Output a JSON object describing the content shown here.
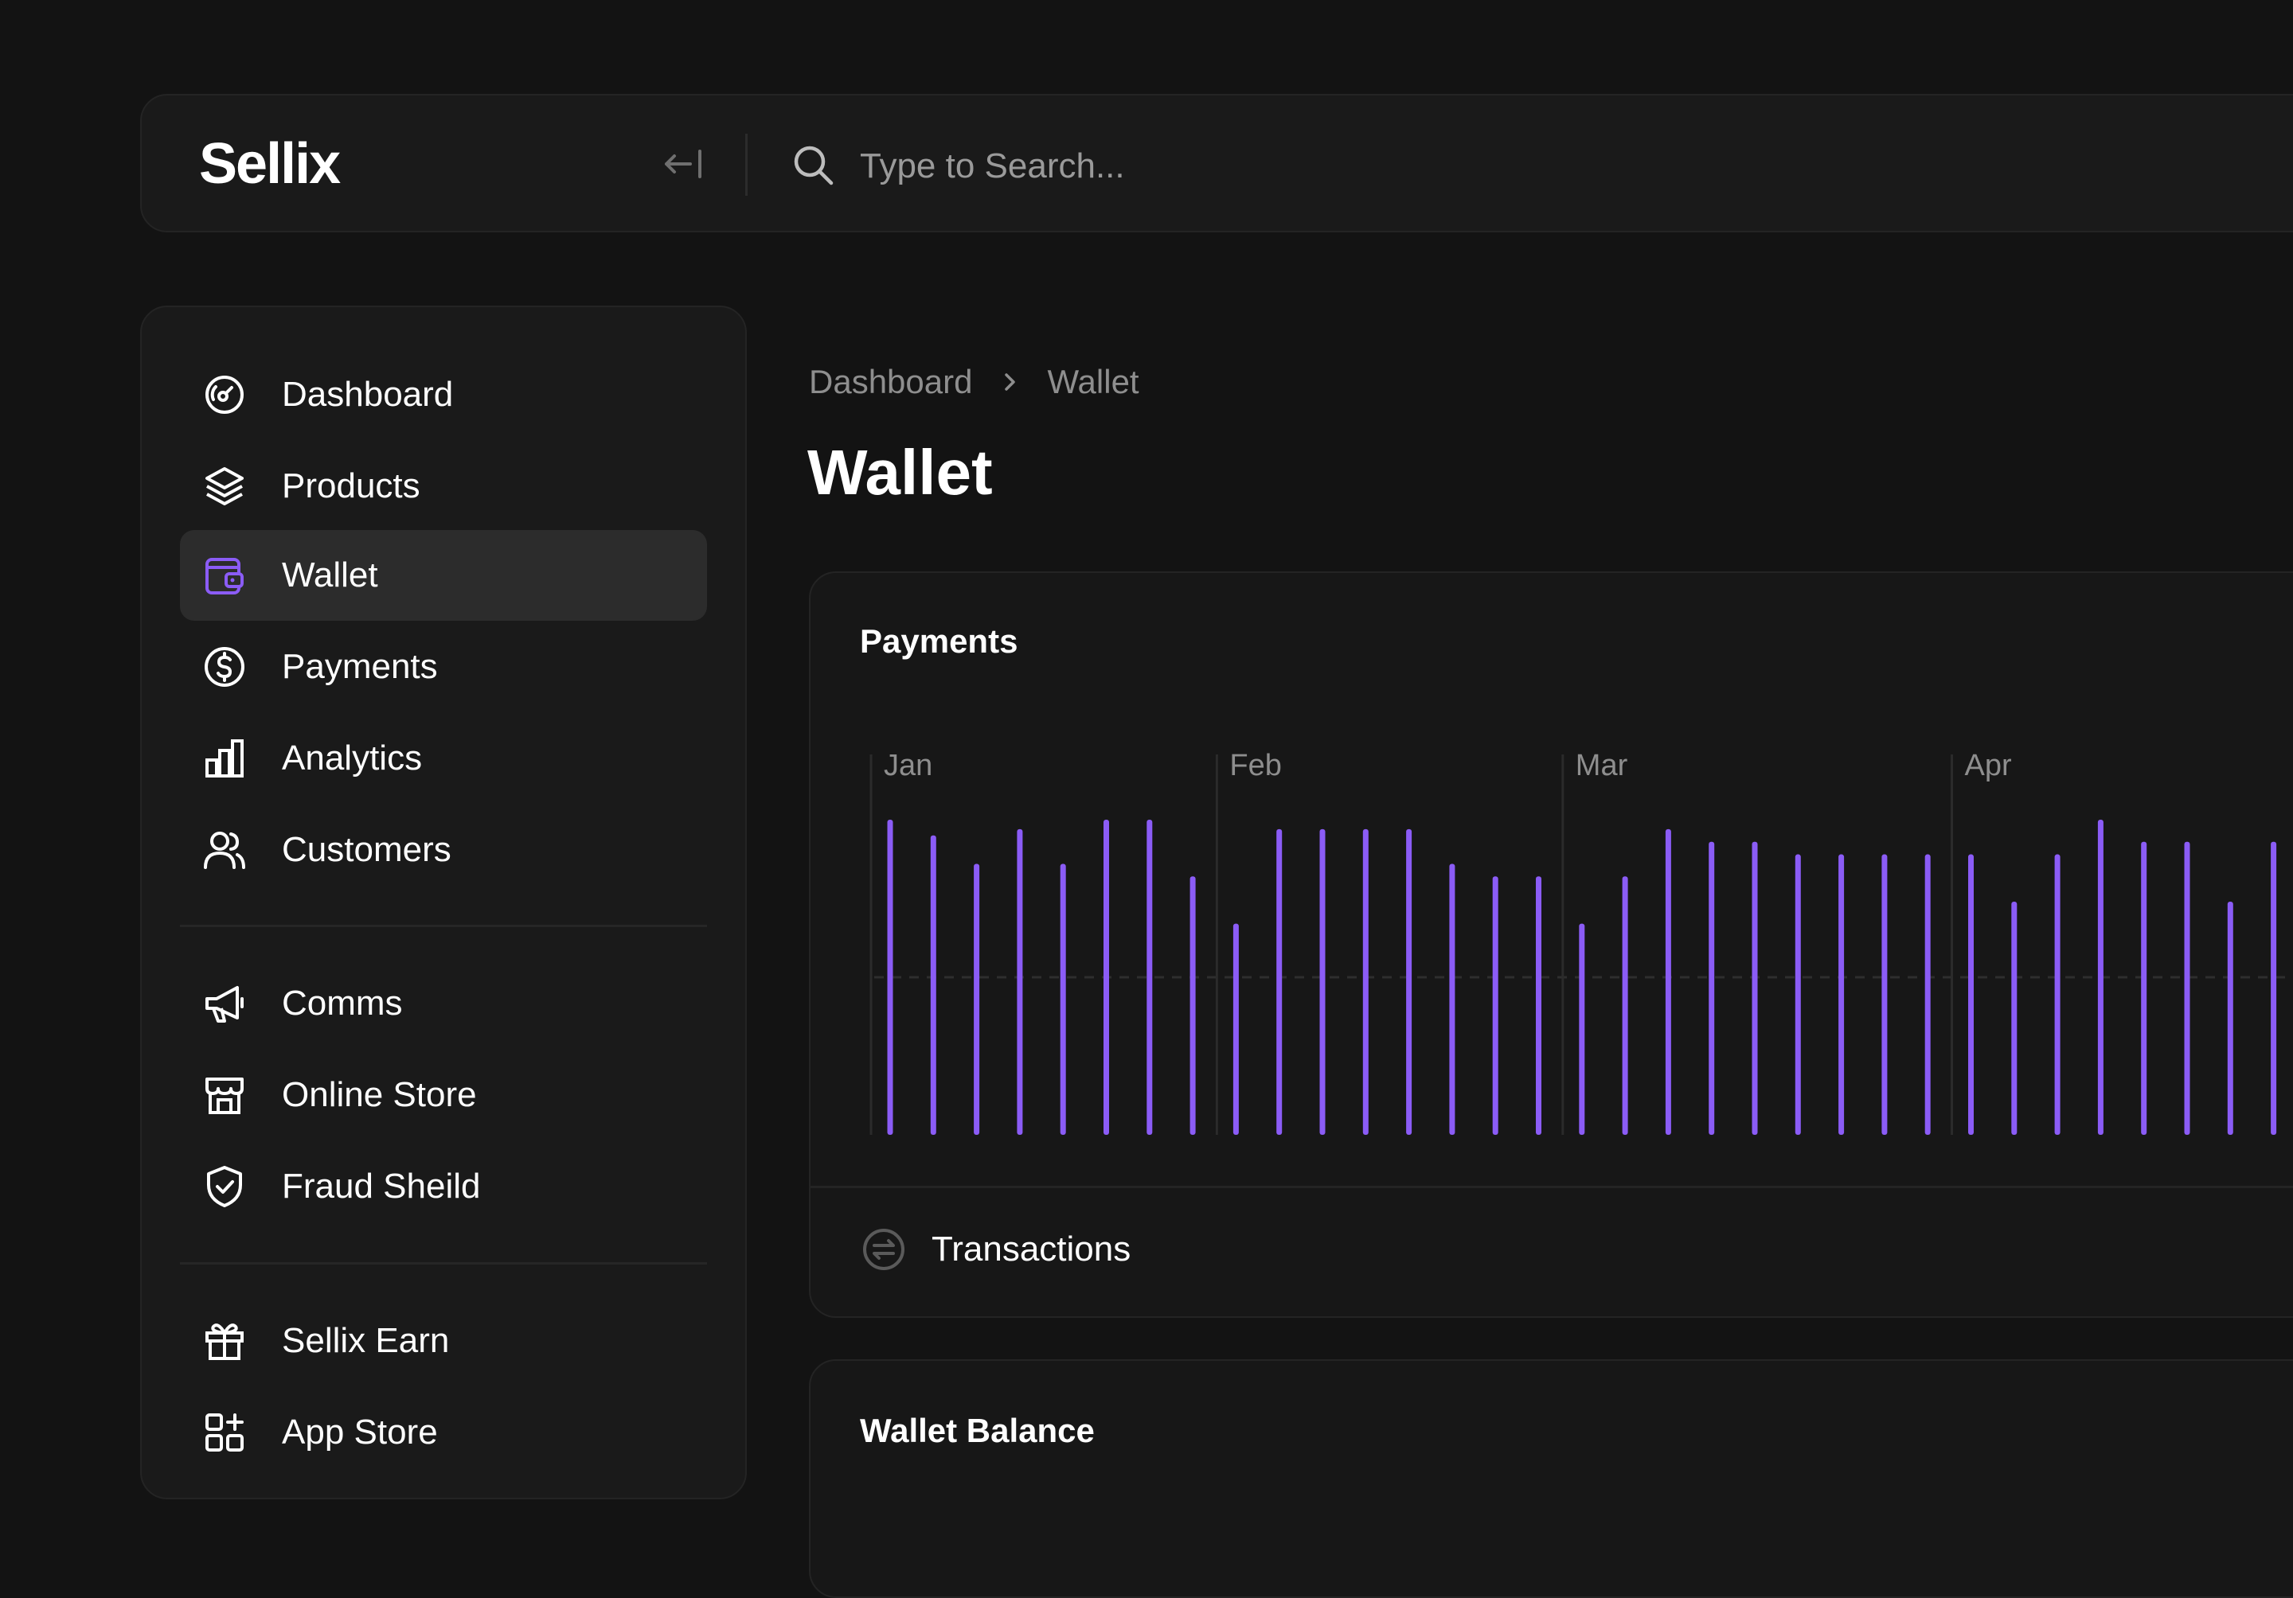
{
  "header": {
    "logo": "Sellix",
    "search_placeholder": "Type to Search..."
  },
  "sidebar": {
    "groups": [
      [
        {
          "label": "Dashboard",
          "icon": "gauge-icon"
        },
        {
          "label": "Products",
          "icon": "layers-icon"
        },
        {
          "label": "Wallet",
          "icon": "wallet-icon",
          "active": true
        },
        {
          "label": "Payments",
          "icon": "dollar-circle-icon"
        },
        {
          "label": "Analytics",
          "icon": "bar-chart-icon"
        },
        {
          "label": "Customers",
          "icon": "users-icon"
        }
      ],
      [
        {
          "label": "Comms",
          "icon": "megaphone-icon"
        },
        {
          "label": "Online Store",
          "icon": "store-icon"
        },
        {
          "label": "Fraud Sheild",
          "icon": "shield-check-icon"
        }
      ],
      [
        {
          "label": "Sellix Earn",
          "icon": "gift-icon"
        },
        {
          "label": "App Store",
          "icon": "apps-add-icon"
        }
      ]
    ]
  },
  "breadcrumb": {
    "items": [
      "Dashboard",
      "Wallet"
    ]
  },
  "page": {
    "title": "Wallet"
  },
  "payments_card": {
    "title": "Payments",
    "footer_label": "Transactions"
  },
  "balance_card": {
    "title": "Wallet Balance"
  },
  "colors": {
    "accent": "#8b5cf6",
    "background": "#131313",
    "panel": "#1a1a1a",
    "active_item": "#2c2c2c"
  },
  "chart_data": {
    "type": "bar",
    "months": [
      "Jan",
      "Feb",
      "Mar",
      "Apr"
    ],
    "month_start_index": [
      0,
      8,
      16,
      25
    ],
    "values": [
      100,
      95,
      86,
      97,
      86,
      100,
      100,
      82,
      67,
      97,
      97,
      97,
      97,
      86,
      82,
      82,
      67,
      82,
      97,
      93,
      93,
      89,
      89,
      89,
      89,
      89,
      74,
      89,
      100,
      93,
      93,
      74,
      93
    ],
    "baseline": 50,
    "ylim": [
      0,
      100
    ],
    "grid": false
  }
}
